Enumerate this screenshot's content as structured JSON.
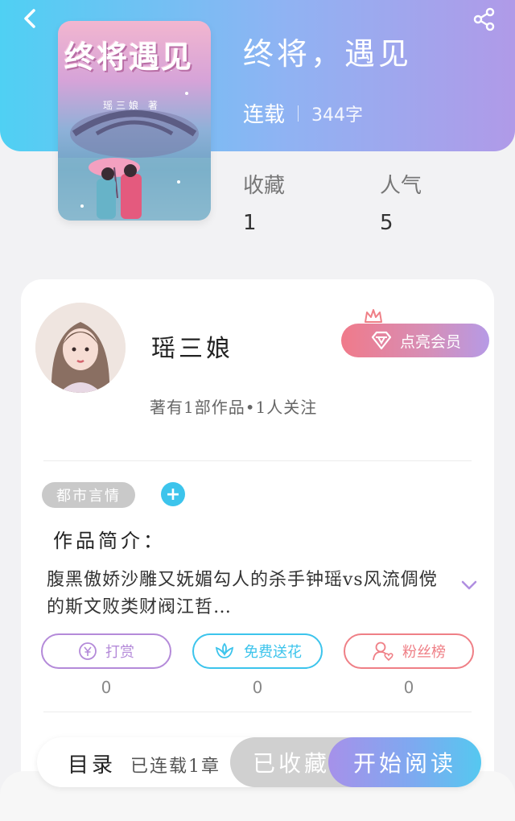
{
  "book": {
    "cover_title": "终将遇见",
    "cover_author": "瑶三娘 著",
    "title": "终将，遇见",
    "status": "连载",
    "word_count": "344字",
    "stats": [
      {
        "label": "收藏",
        "value": "1"
      },
      {
        "label": "人气",
        "value": "5"
      }
    ]
  },
  "author": {
    "name": "瑶三娘",
    "vip_button": "点亮会员",
    "summary": "著有1部作品•1人关注"
  },
  "tags": {
    "genre": "都市言情",
    "add": "+"
  },
  "intro": {
    "heading": "作品简介：",
    "text": "腹黑傲娇沙雕又妩媚勾人的杀手钟瑶vs风流倜傥的斯文败类财阀江哲…"
  },
  "actions": [
    {
      "label": "打赏",
      "count": "0",
      "color": "#b48ad9",
      "icon": "yen-coin-icon"
    },
    {
      "label": "免费送花",
      "count": "0",
      "color": "#3cc4ec",
      "icon": "flower-icon"
    },
    {
      "label": "粉丝榜",
      "count": "0",
      "color": "#ef7f86",
      "icon": "fan-user-icon"
    }
  ],
  "bottom_bar": {
    "toc_label": "目录",
    "toc_status": "已连载1章",
    "collected_button": "已收藏",
    "read_button": "开始阅读"
  },
  "colors": {
    "header_start": "#4fd0f3",
    "header_end": "#b09ae8",
    "accent_blue": "#3cc4ec"
  }
}
